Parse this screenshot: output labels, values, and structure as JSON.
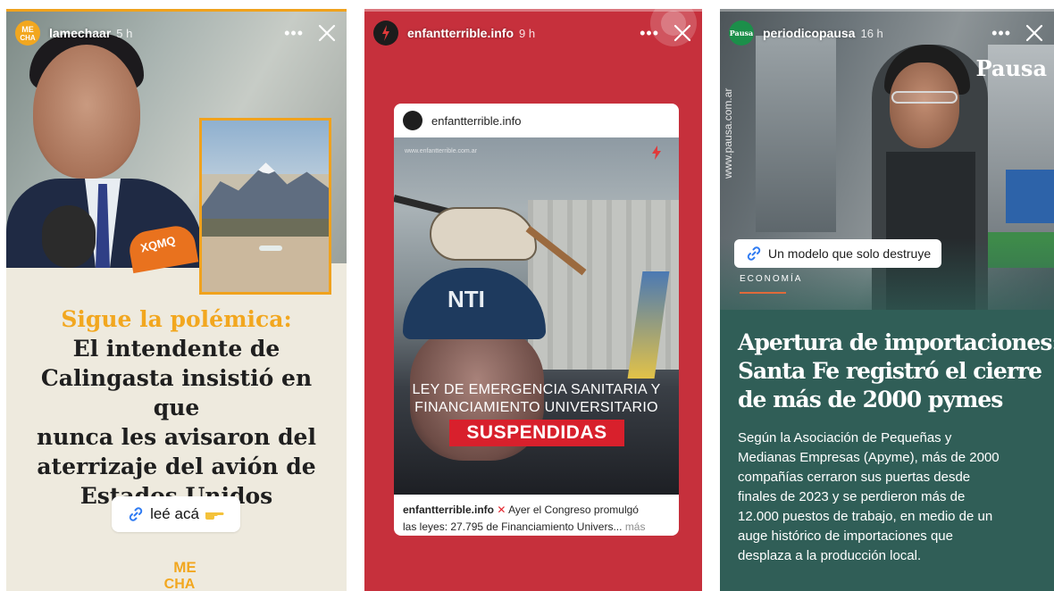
{
  "colors": {
    "story1_background": "#eeeade",
    "story1_accent": "#f2a71f",
    "story2_background": "#c6303c",
    "story2_badge": "#d8202c",
    "story3_background": "#305e57",
    "story3_category_rule": "#e06a3a"
  },
  "stories": [
    {
      "username": "lamechaar",
      "time": "5 h",
      "avatar": {
        "line1": "ME",
        "line2": "CHA"
      },
      "photo_tag": "XQMQ",
      "headline_lead": "Sigue la polémica:",
      "headline_lines": [
        "El intendente de",
        "Calingasta insistió en que",
        "nunca les avisaron del",
        "aterrizaje del avión de",
        "Estados Unidos"
      ],
      "link_label": "leé acá",
      "brand": {
        "line1": "ME",
        "line2": "CHA"
      },
      "more_icon": "more-horizontal-icon",
      "close_icon": "close-icon"
    },
    {
      "username": "enfantterrible.info",
      "time": "9 h",
      "card": {
        "account": "enfantterrible.info",
        "watermark": "www.enfantterrible.com.ar",
        "cap_text": "NTI",
        "caption_line1": "LEY DE EMERGENCIA SANITARIA Y",
        "caption_line2": "FINANCIAMIENTO UNIVERSITARIO",
        "badge": "SUSPENDIDAS",
        "post_user": "enfantterrible.info",
        "post_text_1": "Ayer el Congreso promulgó",
        "post_text_2": "las leyes: 27.795 de Financiamiento Univers...",
        "post_more": "más"
      },
      "more_icon": "more-horizontal-icon",
      "close_icon": "close-icon"
    },
    {
      "username": "periodicopausa",
      "time": "16 h",
      "avatar": "Pausa",
      "side_url": "www.pausa.com.ar",
      "masthead": "Pausa",
      "link_label": "Un modelo que solo destruye",
      "category": "ECONOMÍA",
      "headline_lines": [
        "Apertura de importaciones:",
        "Santa Fe registró el cierre",
        "de más de 2000 pymes"
      ],
      "lead_lines": [
        "Según la Asociación de Pequeñas y",
        "Medianas Empresas (Apyme), más de 2000",
        "compañías cerraron sus puertas desde",
        "finales de 2023 y se perdieron más de",
        "12.000 puestos de trabajo, en medio de un",
        "auge histórico de importaciones que",
        "desplaza a la producción local."
      ],
      "more_icon": "more-horizontal-icon",
      "close_icon": "close-icon"
    }
  ]
}
